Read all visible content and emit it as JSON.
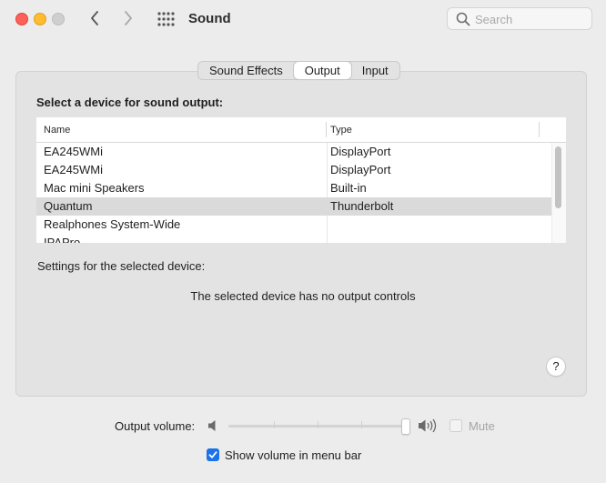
{
  "window": {
    "title": "Sound"
  },
  "search": {
    "placeholder": "Search"
  },
  "tabs": [
    {
      "label": "Sound Effects",
      "selected": false
    },
    {
      "label": "Output",
      "selected": true
    },
    {
      "label": "Input",
      "selected": false
    }
  ],
  "output": {
    "section_title": "Select a device for sound output:",
    "columns": {
      "name": "Name",
      "type": "Type"
    },
    "devices": [
      {
        "name": "EA245WMi",
        "type": "DisplayPort",
        "selected": false
      },
      {
        "name": "EA245WMi",
        "type": "DisplayPort",
        "selected": false
      },
      {
        "name": "Mac mini Speakers",
        "type": "Built-in",
        "selected": false
      },
      {
        "name": "Quantum",
        "type": "Thunderbolt",
        "selected": true
      },
      {
        "name": "Realphones System-Wide",
        "type": "",
        "selected": false
      },
      {
        "name": "IPAPro",
        "type": "",
        "selected": false
      }
    ],
    "settings_label": "Settings for the selected device:",
    "no_controls_text": "The selected device has no output controls",
    "help_label": "?"
  },
  "volume": {
    "label": "Output volume:",
    "level": 1.0,
    "mute_label": "Mute",
    "mute_checked": false,
    "mute_enabled": false
  },
  "menu_bar": {
    "label": "Show volume in menu bar",
    "checked": true
  },
  "colors": {
    "accent": "#1a73e8",
    "close": "#fe5f57",
    "minimize": "#febc2e",
    "zoom_disabled": "#cfcfcf"
  }
}
